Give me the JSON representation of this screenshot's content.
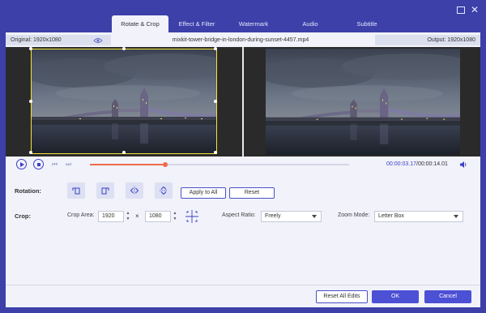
{
  "window": {
    "tabs": [
      "Rotate & Crop",
      "Effect & Filter",
      "Watermark",
      "Audio",
      "Subtitle"
    ],
    "active_tab": 0,
    "minimize_icon": "minimize-icon",
    "close_label": "✕"
  },
  "info": {
    "original": "Original: 1920x1080",
    "filename": "mixkit-tower-bridge-in-london-during-sunset-4457.mp4",
    "output": "Output: 1920x1080"
  },
  "playback": {
    "current_time": "00:00:03.17",
    "separator": "/",
    "total_time": "00:00:14.01",
    "progress": 0.29
  },
  "rotation": {
    "label": "Rotation:",
    "apply_all": "Apply to All",
    "reset": "Reset"
  },
  "crop": {
    "label": "Crop:",
    "area_label": "Crop Area:",
    "width": "1920",
    "height": "1080",
    "times": "×",
    "aspect_label": "Aspect Ratio:",
    "aspect_value": "Freely",
    "zoom_label": "Zoom Mode:",
    "zoom_value": "Letter Box"
  },
  "footer": {
    "reset_all": "Reset All Edits",
    "ok": "OK",
    "cancel": "Cancel"
  },
  "colors": {
    "accent": "#4c50d4",
    "frame": "#3c40a8",
    "progress": "#f06a4a",
    "crop_border": "#f5e33a"
  }
}
